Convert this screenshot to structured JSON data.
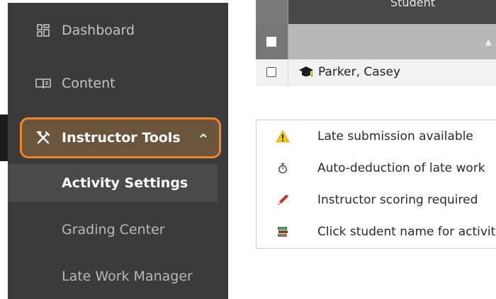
{
  "sidebar": {
    "items": [
      {
        "label": "Dashboard",
        "icon": "dashboard-icon"
      },
      {
        "label": "Content",
        "icon": "book-icon"
      },
      {
        "label": "Instructor Tools",
        "icon": "tools-icon",
        "expanded": true
      }
    ],
    "subitems": [
      {
        "label": "Activity Settings",
        "selected": true
      },
      {
        "label": "Grading Center"
      },
      {
        "label": "Late Work Manager"
      }
    ],
    "accent_color": "#f0852a"
  },
  "table": {
    "header_student": "Student",
    "rows": [
      {
        "student": "Parker, Casey",
        "icon": "graduation-cap-icon"
      }
    ]
  },
  "legend": [
    {
      "icon": "warning-icon",
      "text": "Late submission available"
    },
    {
      "icon": "stopwatch-icon",
      "text": "Auto-deduction of late work"
    },
    {
      "icon": "pencil-icon",
      "text": "Instructor scoring required"
    },
    {
      "icon": "books-icon",
      "text": "Click student name for activity"
    }
  ]
}
